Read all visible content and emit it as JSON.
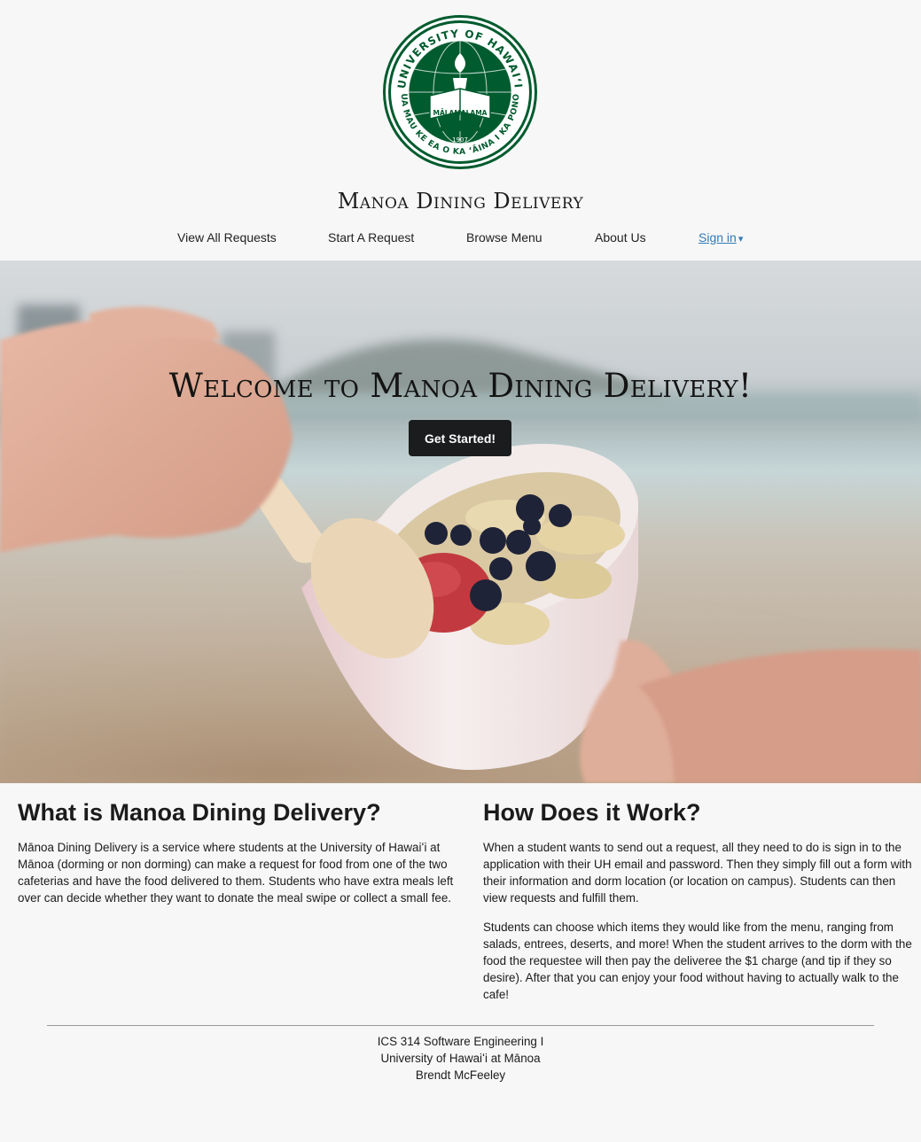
{
  "logo": {
    "ring_text_top": "UNIVERSITY OF HAWAIʻI",
    "ring_text_bottom": "UA MAU KE EA O KA ʻĀINA I KA PONO",
    "banner": "MĀLAMALAMA",
    "year": "1907",
    "color": "#005b2e"
  },
  "header": {
    "title": "Manoa Dining Delivery"
  },
  "nav": {
    "items": [
      {
        "label": "View All Requests"
      },
      {
        "label": "Start A Request"
      },
      {
        "label": "Browse Menu"
      },
      {
        "label": "About Us"
      }
    ],
    "signin_label": "Sign in",
    "signin_icon": "caret-down-icon",
    "link_color": "#337ab7"
  },
  "hero": {
    "title": "Welcome to Manoa Dining Delivery!",
    "button_label": "Get Started!"
  },
  "sections": {
    "what": {
      "heading": "What is Manoa Dining Delivery?",
      "body": "Mānoa Dining Delivery is a service where students at the University of Hawaiʻi at Mānoa (dorming or non dorming) can make a request for food from one of the two cafeterias and have the food delivered to them. Students who have extra meals left over can decide whether they want to donate the meal swipe or collect a small fee."
    },
    "how": {
      "heading": "How Does it Work?",
      "body1": "When a student wants to send out a request, all they need to do is sign in to the application with their UH email and password. Then they simply fill out a form with their information and dorm location (or location on campus). Students can then view requests and fulfill them.",
      "body2": "Students can choose which items they would like from the menu, ranging from salads, entrees, deserts, and more! When the student arrives to the dorm with the food the requestee will then pay the deliveree the $1 charge (and tip if they so desire). After that you can enjoy your food without having to actually walk to the cafe!"
    }
  },
  "footer": {
    "line1": "ICS 314 Software Engineering I",
    "line2": "University of Hawaiʻi at Mānoa",
    "line3": "Brendt McFeeley"
  }
}
